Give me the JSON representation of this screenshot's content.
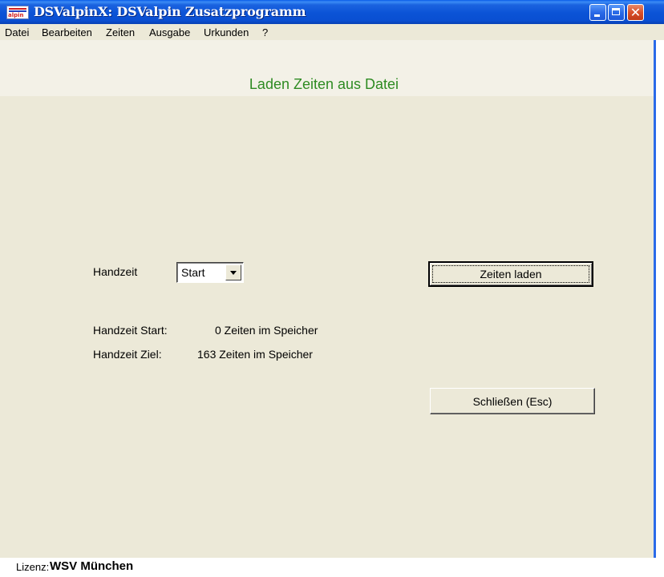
{
  "window": {
    "title": "DSValpinX: DSValpin Zusatzprogramm",
    "icon_text": "alpin",
    "close_glyph": "✕"
  },
  "menu": {
    "items": [
      "Datei",
      "Bearbeiten",
      "Zeiten",
      "Ausgabe",
      "Urkunden",
      "?"
    ]
  },
  "header": {
    "title": "Laden Zeiten aus Datei"
  },
  "form": {
    "handzeit_label": "Handzeit",
    "handzeit_select": {
      "value": "Start"
    },
    "load_button": "Zeiten laden",
    "close_button": "Schließen (Esc)",
    "stats": [
      {
        "label": "Handzeit Start:",
        "value": "0 Zeiten im Speicher"
      },
      {
        "label": "Handzeit Ziel:",
        "value": "163 Zeiten im Speicher"
      }
    ]
  },
  "statusbar": {
    "license_label": "Lizenz:",
    "license_value": "WSV München"
  },
  "colors": {
    "header_title": "#2e8b22",
    "window_bg": "#ece9d8",
    "titlebar": "#0b53d6"
  }
}
